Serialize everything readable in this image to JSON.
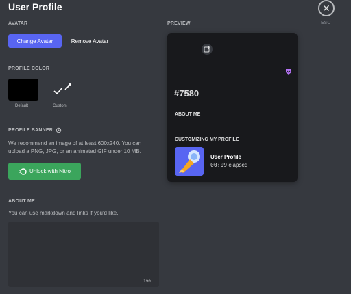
{
  "header": {
    "title": "User Profile",
    "close_icon": "close-icon",
    "esc_label": "ESC"
  },
  "avatar": {
    "label": "AVATAR",
    "change_label": "Change Avatar",
    "remove_label": "Remove Avatar"
  },
  "profile_color": {
    "label": "PROFILE COLOR",
    "default_label": "Default",
    "custom_label": "Custom",
    "default_color": "#000000",
    "check_icon": "checkmark-icon",
    "picker_icon": "eyedropper-icon"
  },
  "banner": {
    "label": "PROFILE BANNER",
    "nitro_icon": "nitro-icon",
    "description_line1": "We recommend an image of at least 600x240. You can",
    "description_line2": "upload a PNG, JPG, or an animated GIF under 10 MB.",
    "unlock_label": "Unlock with Nitro"
  },
  "about_me": {
    "label": "ABOUT ME",
    "hint": "You can use markdown and links if you'd like.",
    "value": "",
    "char_remaining": "190"
  },
  "preview": {
    "label": "PREVIEW",
    "tag": "#7580",
    "about_heading": "ABOUT ME",
    "activity_heading": "CUSTOMIZING MY PROFILE",
    "activity_title": "User Profile",
    "activity_time": "00:09",
    "activity_elapsed": "elapsed"
  },
  "colors": {
    "accent": "#5865f2",
    "nitro_green": "#3ba55c",
    "background": "#36393f",
    "card": "#18191c"
  }
}
